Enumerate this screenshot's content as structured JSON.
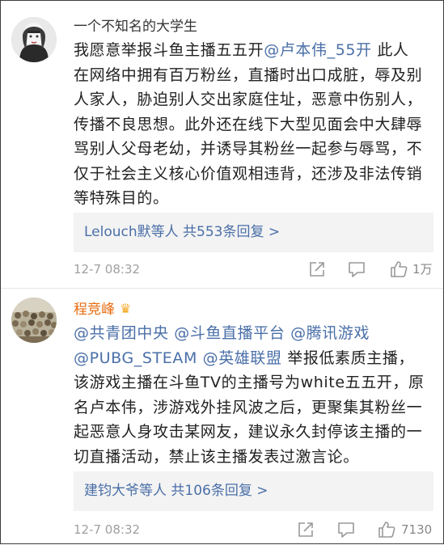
{
  "comments": [
    {
      "username": "一个不知名的大学生",
      "body_lines": [
        [
          "我愿意举报斗鱼主播五五开",
          "@卢本伟_55开",
          " 此人"
        ],
        [
          "在网络中拥有百万粉丝，直播时出口成脏，辱及别"
        ],
        [
          "人家人，胁迫别人交出家庭住址，恶意中伤别人，"
        ],
        [
          "传播不良思想。此外还在线下大型见面会中大肆辱"
        ],
        [
          "骂别人父母老幼，并诱导其粉丝一起参与辱骂，不"
        ],
        [
          "仅于社会主义核心价值观相违背，还涉及非法传销"
        ],
        [
          "等特殊目的。"
        ]
      ],
      "reply_summary": "Lelouch默等人 共553条回复 >",
      "time": "12-7 08:32",
      "like_count": "1万"
    },
    {
      "username": "程竞峰",
      "badge": "crown-badge",
      "body_lines": [
        [
          "@共青团中央",
          " ",
          "@斗鱼直播平台",
          " ",
          "@腾讯游戏"
        ],
        [
          "@PUBG_STEAM",
          " ",
          "@英雄联盟",
          " 举报低素质主播，"
        ],
        [
          "该游戏主播在斗鱼TV的主播号为white五五开，原"
        ],
        [
          "名卢本伟，涉游戏外挂风波之后，更聚集其粉丝一"
        ],
        [
          "起恶意人身攻击某网友，建议永久封停该主播的一"
        ],
        [
          "切直播活动，禁止该主播发表过激言论。"
        ]
      ],
      "reply_summary": "建钧大爷等人 共106条回复 >",
      "time": "12-7 08:32",
      "like_count": "7130"
    }
  ],
  "colors": {
    "link": "#4a6fa8",
    "username_1": "#333333",
    "username_2": "#e86b0f",
    "body": "#222222",
    "meta": "#a0a0a0",
    "reply_bg": "#f3f3f3"
  },
  "icons": [
    "share-icon",
    "comment-icon",
    "like-icon"
  ]
}
